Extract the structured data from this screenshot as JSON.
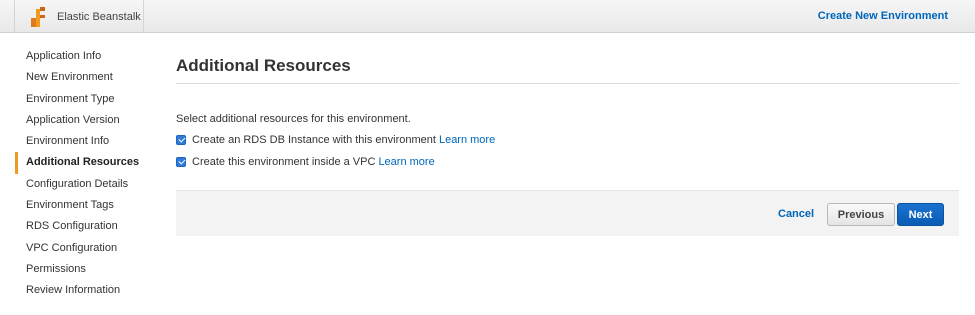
{
  "header": {
    "service_name": "Elastic Beanstalk",
    "service_icon": "elastic-beanstalk-icon",
    "create_link": "Create New Environment"
  },
  "sidebar": {
    "items": [
      {
        "label": "Application Info",
        "active": false
      },
      {
        "label": "New Environment",
        "active": false
      },
      {
        "label": "Environment Type",
        "active": false
      },
      {
        "label": "Application Version",
        "active": false
      },
      {
        "label": "Environment Info",
        "active": false
      },
      {
        "label": "Additional Resources",
        "active": true
      },
      {
        "label": "Configuration Details",
        "active": false
      },
      {
        "label": "Environment Tags",
        "active": false
      },
      {
        "label": "RDS Configuration",
        "active": false
      },
      {
        "label": "VPC Configuration",
        "active": false
      },
      {
        "label": "Permissions",
        "active": false
      },
      {
        "label": "Review Information",
        "active": false
      }
    ]
  },
  "main": {
    "title": "Additional Resources",
    "intro": "Select additional resources for this environment.",
    "options": [
      {
        "label": "Create an RDS DB Instance with this environment",
        "link": "Learn more",
        "checked": true
      },
      {
        "label": "Create this environment inside a VPC",
        "link": "Learn more",
        "checked": true
      }
    ]
  },
  "footer": {
    "cancel": "Cancel",
    "previous": "Previous",
    "next": "Next"
  },
  "colors": {
    "accent": "#f19a1d",
    "link": "#0066bb",
    "primary_button": "#0a5bb4"
  }
}
